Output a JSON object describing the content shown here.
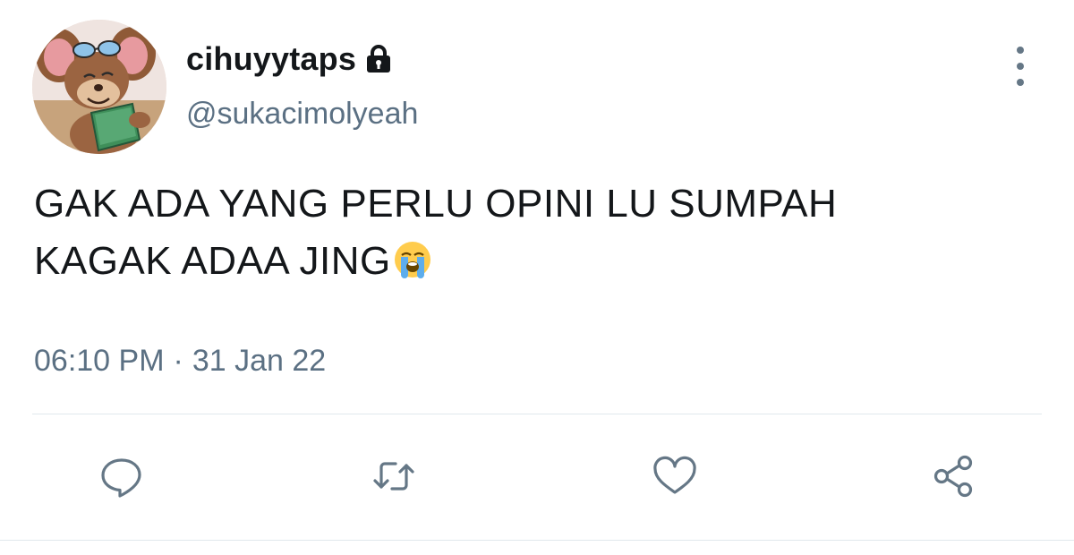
{
  "author": {
    "display_name": "cihuyytaps",
    "username": "@sukacimolyeah",
    "protected_icon": "lock-icon",
    "avatar": "avatar-mouse-reading-book"
  },
  "tweet": {
    "text_line1": "GAK ADA YANG PERLU OPINI LU SUMPAH",
    "text_line2": "KAGAK ADAA JING",
    "emoji": "loudly-crying-face-emoji",
    "time": "06:10 PM",
    "separator": "·",
    "date": "31 Jan 22"
  },
  "actions": [
    {
      "name": "reply",
      "icon": "reply-icon"
    },
    {
      "name": "retweet",
      "icon": "retweet-icon"
    },
    {
      "name": "like",
      "icon": "heart-icon"
    },
    {
      "name": "share",
      "icon": "share-icon"
    }
  ],
  "colors": {
    "primary_text": "#14171a",
    "secondary_text": "#5b7083",
    "icon_gray": "#657786",
    "divider": "#e1e8ed"
  }
}
